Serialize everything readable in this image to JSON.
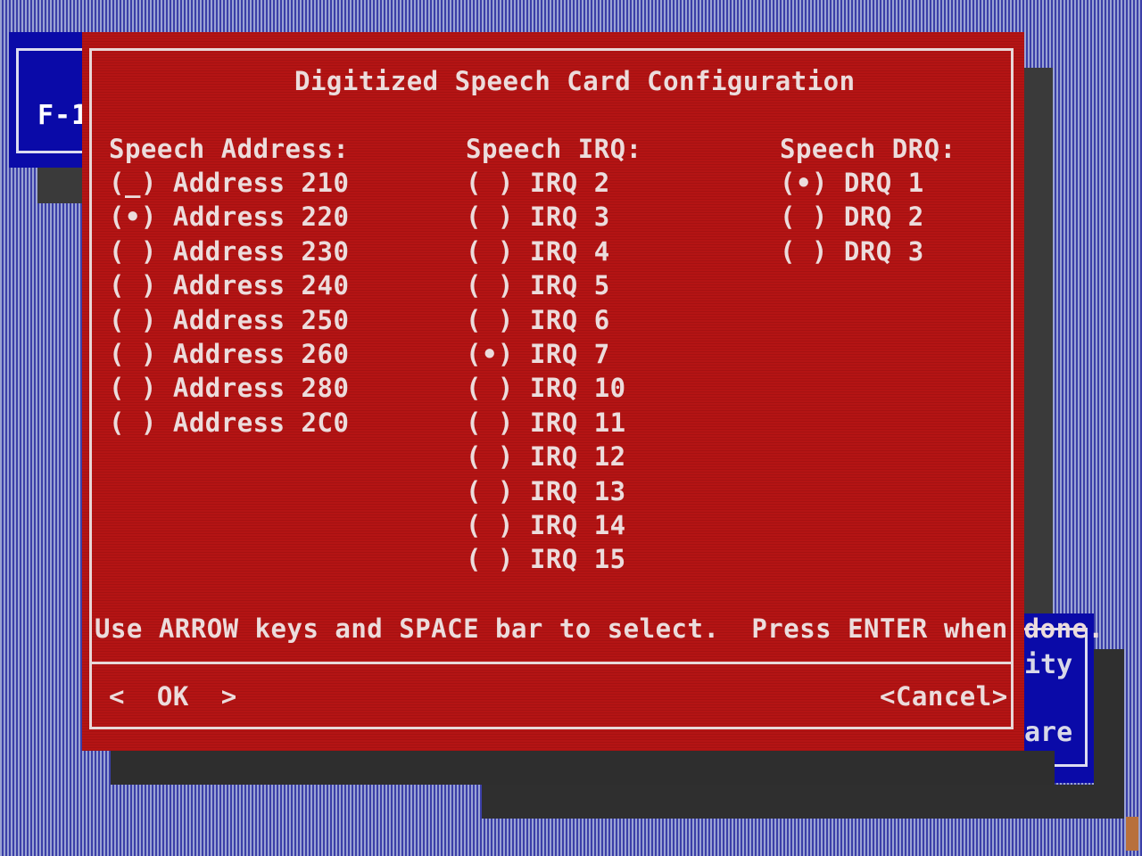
{
  "background": {
    "left_window_label": "F-1",
    "peek_text_1": "ity",
    "peek_text_2": "are"
  },
  "dialog": {
    "title": "Digitized Speech Card Configuration",
    "address": {
      "header": "Speech Address:",
      "options": [
        {
          "mark": "(_)",
          "label": "Address 210"
        },
        {
          "mark": "(•)",
          "label": "Address 220"
        },
        {
          "mark": "( )",
          "label": "Address 230"
        },
        {
          "mark": "( )",
          "label": "Address 240"
        },
        {
          "mark": "( )",
          "label": "Address 250"
        },
        {
          "mark": "( )",
          "label": "Address 260"
        },
        {
          "mark": "( )",
          "label": "Address 280"
        },
        {
          "mark": "( )",
          "label": "Address 2C0"
        }
      ]
    },
    "irq": {
      "header": "Speech IRQ:",
      "options": [
        {
          "mark": "( )",
          "label": "IRQ 2"
        },
        {
          "mark": "( )",
          "label": "IRQ 3"
        },
        {
          "mark": "( )",
          "label": "IRQ 4"
        },
        {
          "mark": "( )",
          "label": "IRQ 5"
        },
        {
          "mark": "( )",
          "label": "IRQ 6"
        },
        {
          "mark": "(•)",
          "label": "IRQ 7"
        },
        {
          "mark": "( )",
          "label": "IRQ 10"
        },
        {
          "mark": "( )",
          "label": "IRQ 11"
        },
        {
          "mark": "( )",
          "label": "IRQ 12"
        },
        {
          "mark": "( )",
          "label": "IRQ 13"
        },
        {
          "mark": "( )",
          "label": "IRQ 14"
        },
        {
          "mark": "( )",
          "label": "IRQ 15"
        }
      ]
    },
    "drq": {
      "header": "Speech DRQ:",
      "options": [
        {
          "mark": "(•)",
          "label": "DRQ 1"
        },
        {
          "mark": "( )",
          "label": "DRQ 2"
        },
        {
          "mark": "( )",
          "label": "DRQ 3"
        }
      ]
    },
    "hint": "Use ARROW keys and SPACE bar to select.  Press ENTER when done.",
    "ok_label": "<  OK  >",
    "cancel_label": "<Cancel>"
  },
  "colors": {
    "dialog_bg": "#b41414",
    "text": "#ecdcdc",
    "accent_blue": "#0a0aa8"
  }
}
